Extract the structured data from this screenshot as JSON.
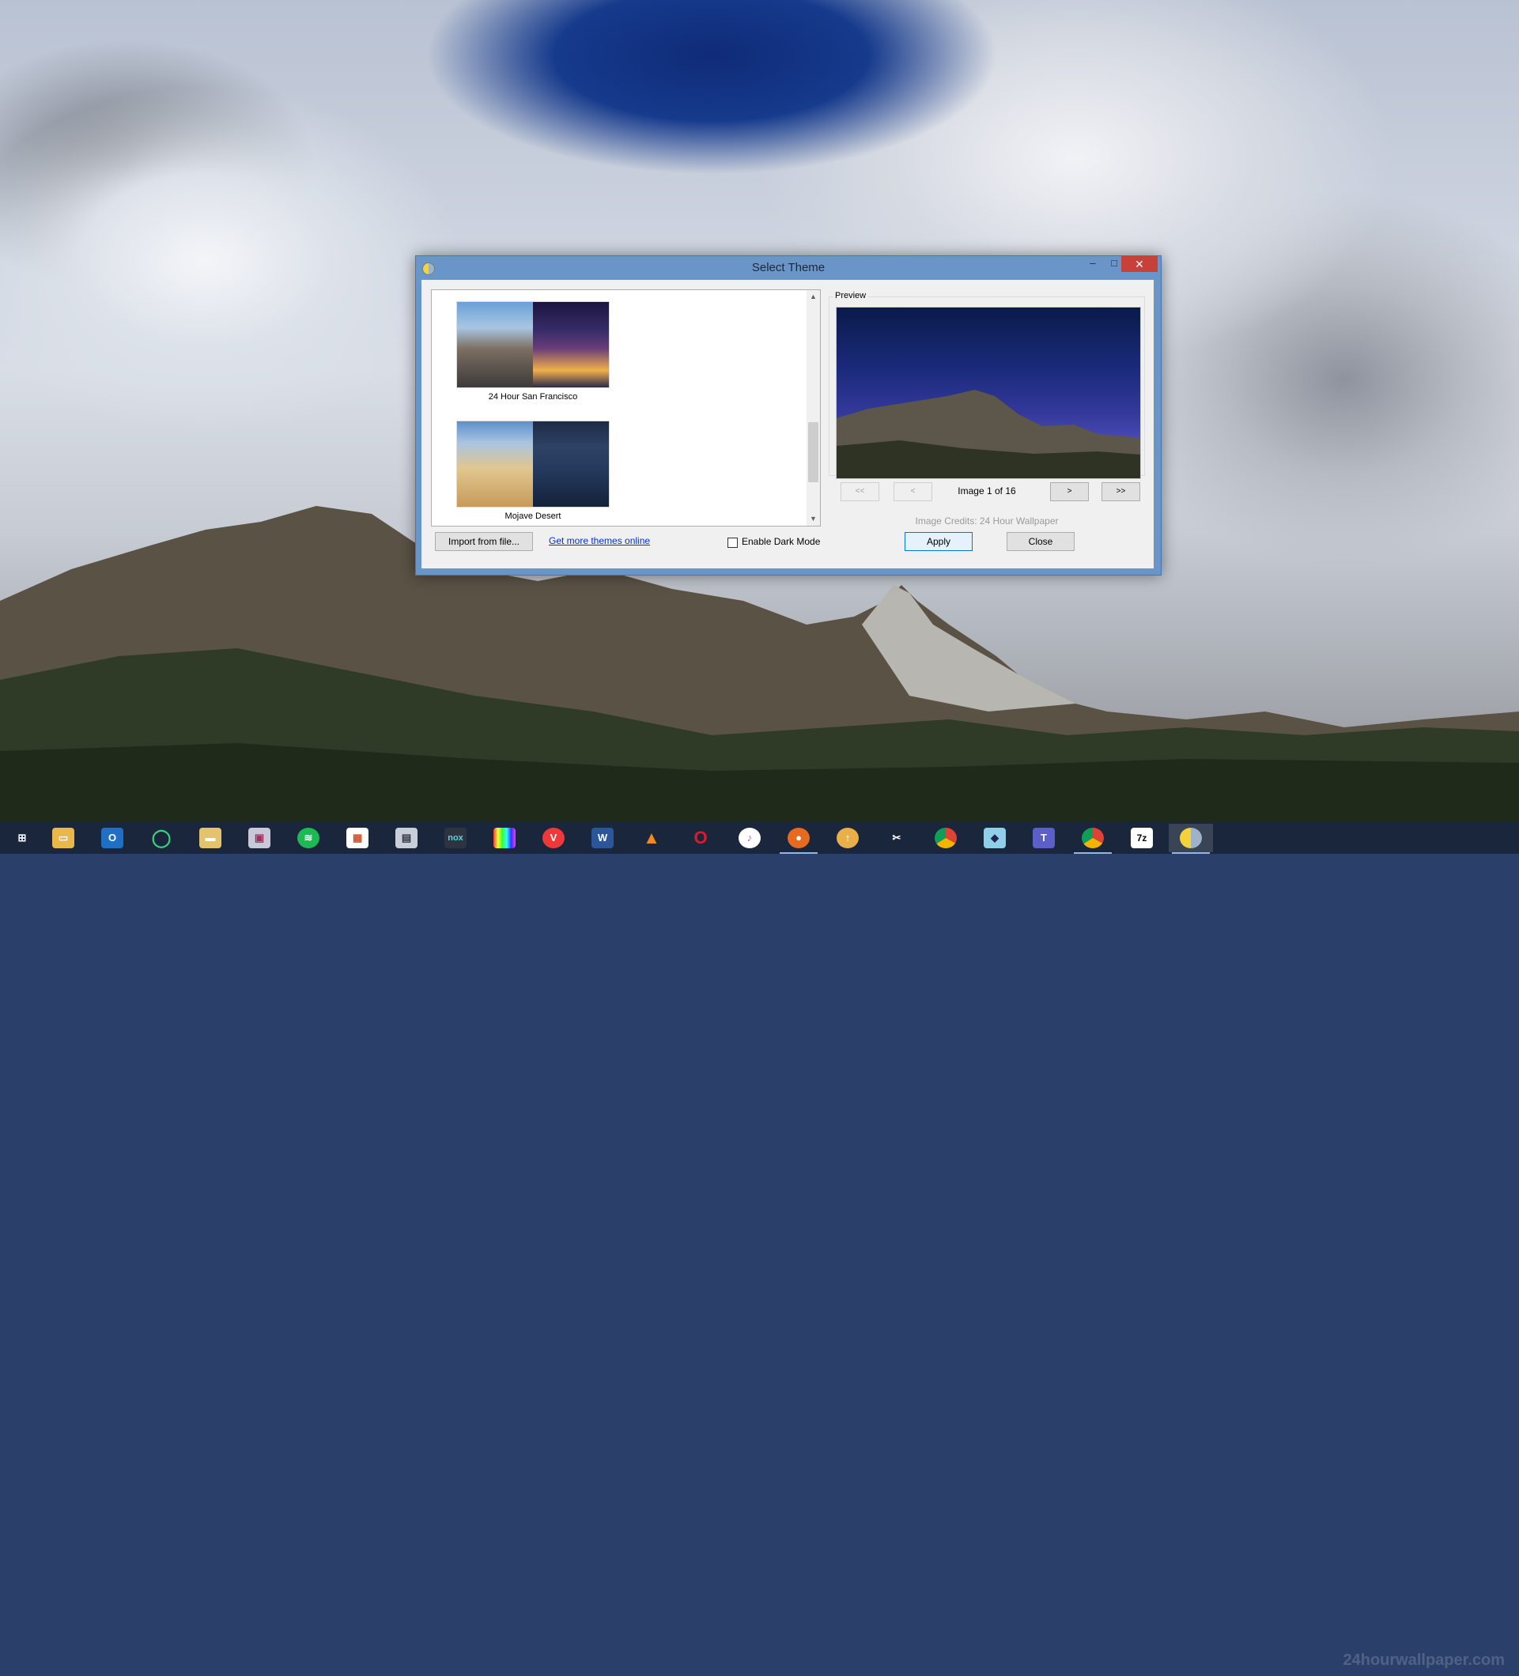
{
  "dialog": {
    "title": "Select Theme",
    "controls": {
      "minimize": "–",
      "maximize": "□",
      "close": "✕"
    },
    "themes": [
      {
        "name": "24 Hour San Francisco"
      },
      {
        "name": "Mojave Desert"
      }
    ],
    "preview": {
      "label": "Preview",
      "first_label": "<<",
      "prev_label": "<",
      "next_label": ">",
      "last_label": ">>",
      "counter": "Image 1 of 16",
      "credits": "Image Credits: 24 Hour Wallpaper"
    },
    "import_label": "Import from file...",
    "more_link": "Get more themes online",
    "dark_mode": {
      "label": "Enable Dark Mode",
      "checked": false
    },
    "apply_label": "Apply",
    "close_label": "Close"
  },
  "taskbar": {
    "watermark": "24hourwallpaper.com",
    "icons": [
      "windows-start-icon",
      "file-explorer-icon",
      "outlook-icon",
      "o-ring-app-icon",
      "folder-icon",
      "photo-app-icon",
      "spotify-icon",
      "grid-app-icon",
      "screenshot-app-icon",
      "nox-icon",
      "colors-app-icon",
      "vivaldi-icon",
      "word-icon",
      "vlc-icon",
      "opera-icon",
      "itunes-icon",
      "firefox-icon",
      "dropcloud-icon",
      "snipping-tool-icon",
      "chrome-icon",
      "eraser-app-icon",
      "teams-icon",
      "chrome-alt-icon",
      "7zip-icon",
      "wallpaper-app-icon"
    ]
  }
}
